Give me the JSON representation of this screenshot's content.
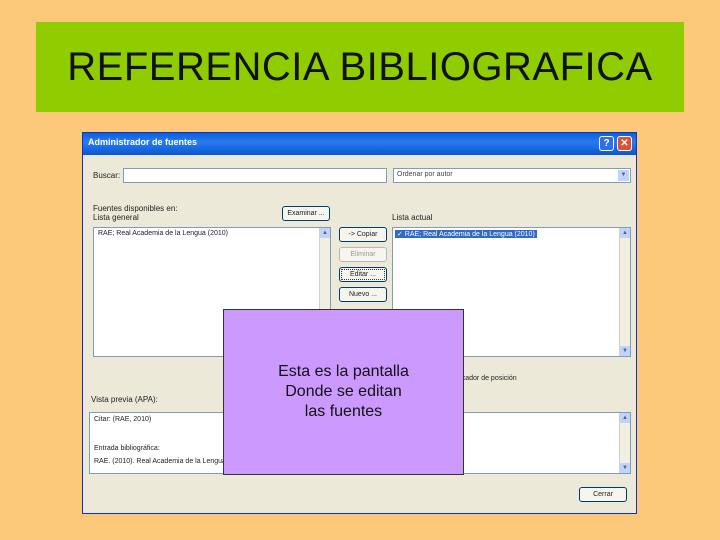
{
  "slide": {
    "title": "REFERENCIA BIBLIOGRAFICA"
  },
  "dialog": {
    "title": "Administrador de fuentes",
    "help_label": "?",
    "close_label": "✕",
    "search_label": "Buscar:",
    "search_value": "",
    "sort_value": "Ordenar por autor",
    "sources_label": "Fuentes disponibles en:",
    "master_list_label": "Lista general",
    "browse_button": "Examinar ...",
    "current_list_label": "Lista actual",
    "master_items": [
      "RAE; Real Academia de la Lengua (2010)"
    ],
    "current_items": [
      "✓ RAE; Real Academia de la Lengua (2010)"
    ],
    "copy_button": "-> Copiar",
    "delete_button": "Eliminar",
    "edit_button": "Editar ...",
    "new_button": "Nuevo ...",
    "placeholder_note": "✓ fuente citada ? marcador de posición",
    "preview_label": "Vista previa (APA):",
    "preview_lines": [
      "Citar: (RAE, 2010)",
      "Entrada bibliográfica:",
      "RAE. (2010). Real Academia de la Lengua."
    ],
    "close_button": "Cerrar"
  },
  "overlay": {
    "text": "Esta es la pantalla\nDonde se editan\nlas fuentes"
  },
  "colors": {
    "background": "#fcc97a",
    "title_box": "#8fcc00",
    "overlay": "#cc99ff",
    "titlebar": "#0a5fd8"
  }
}
